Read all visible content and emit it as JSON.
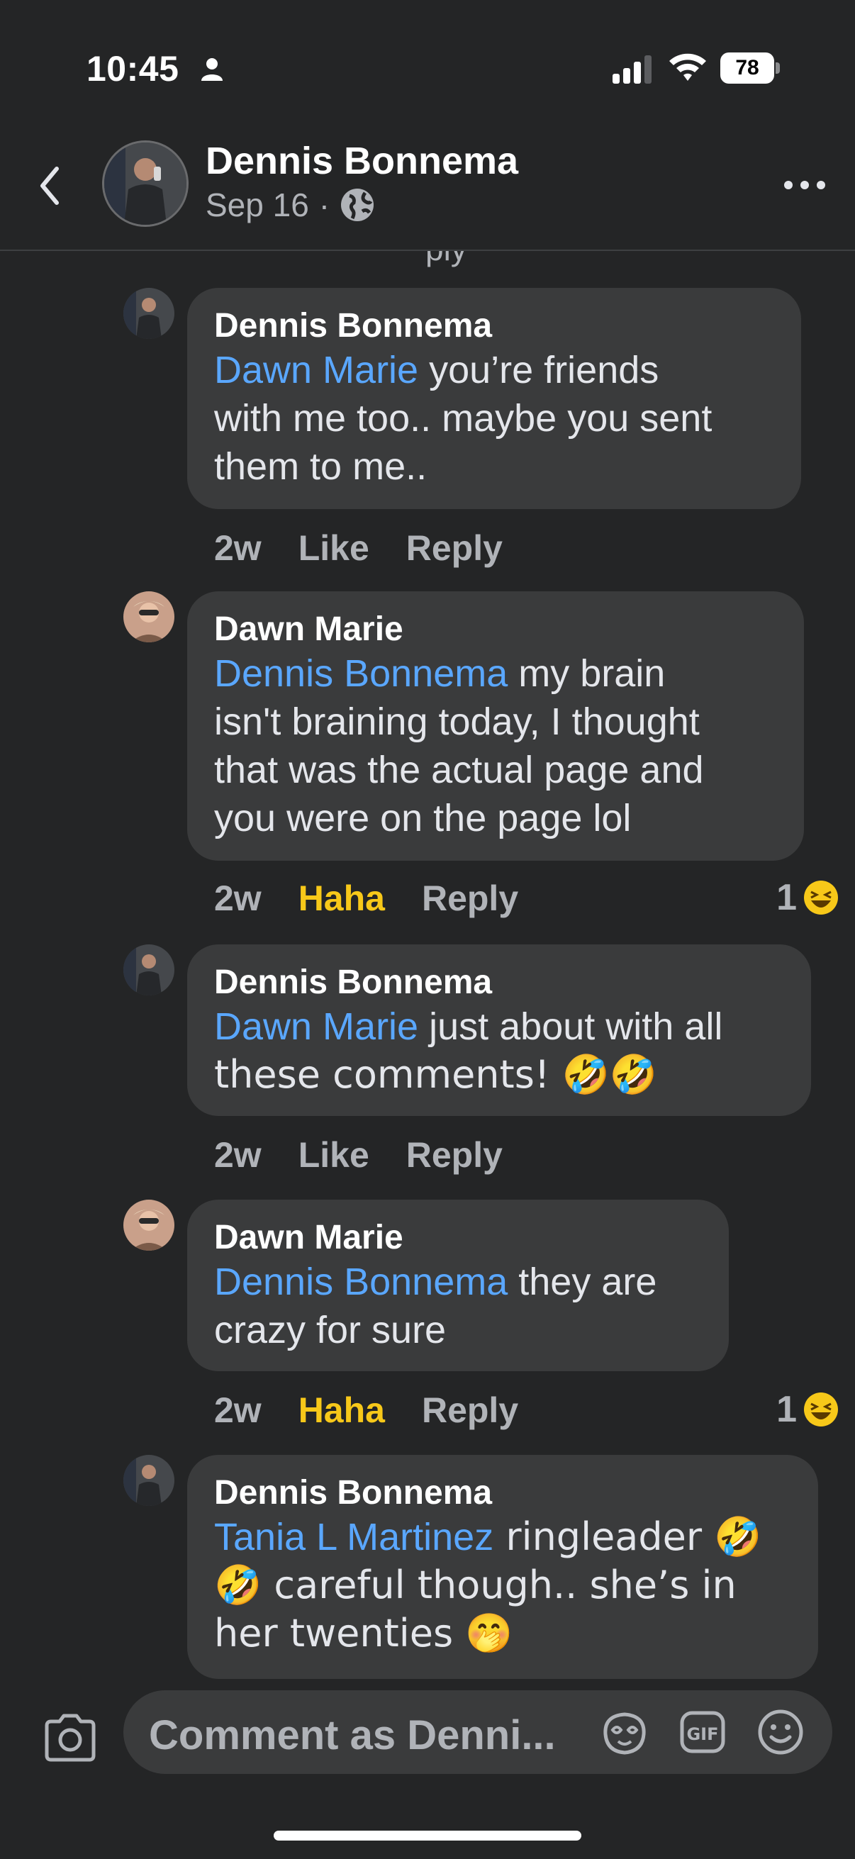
{
  "status_bar": {
    "time": "10:45",
    "battery": "78"
  },
  "header": {
    "name": "Dennis Bonnema",
    "date": "Sep 16",
    "separator": "·"
  },
  "comments": [
    {
      "author": "Dennis Bonnema",
      "mention": "Dawn Marie",
      "lines": [
        " you’re friends",
        "with me too.. maybe you sent",
        "them to me.."
      ],
      "time": "2w",
      "like": "Like",
      "reply": "Reply"
    },
    {
      "author": "Dawn Marie",
      "mention": "Dennis Bonnema",
      "lines": [
        " my brain",
        "isn't braining today, I thought",
        "that was the actual page and",
        "you were on the page lol"
      ],
      "time": "2w",
      "like": "Haha",
      "reply": "Reply",
      "reaction_count": "1"
    },
    {
      "author": "Dennis Bonnema",
      "mention": "Dawn Marie",
      "lines": [
        " just about with all",
        "these comments! 🤣🤣"
      ],
      "time": "2w",
      "like": "Like",
      "reply": "Reply"
    },
    {
      "author": "Dawn Marie",
      "mention": "Dennis Bonnema",
      "lines": [
        " they are",
        "crazy for sure"
      ],
      "time": "2w",
      "like": "Haha",
      "reply": "Reply",
      "reaction_count": "1"
    },
    {
      "author": "Dennis Bonnema",
      "mention": "Tania L Martinez",
      "lines": [
        " ringleader 🤣",
        "🤣  careful though.. she’s in",
        "her twenties 🤭"
      ]
    }
  ],
  "composer": {
    "placeholder": "Comment as Denni..."
  },
  "colors": {
    "background": "#242526",
    "bubble": "#3a3b3c",
    "mention": "#5aa7ff",
    "haha": "#f7c819",
    "muted": "#b0b3b8"
  },
  "icons": [
    "back-icon",
    "globe-icon",
    "more-icon",
    "camera-icon",
    "avatar-sticker-icon",
    "gif-icon",
    "emoji-icon",
    "haha-reaction-icon"
  ]
}
